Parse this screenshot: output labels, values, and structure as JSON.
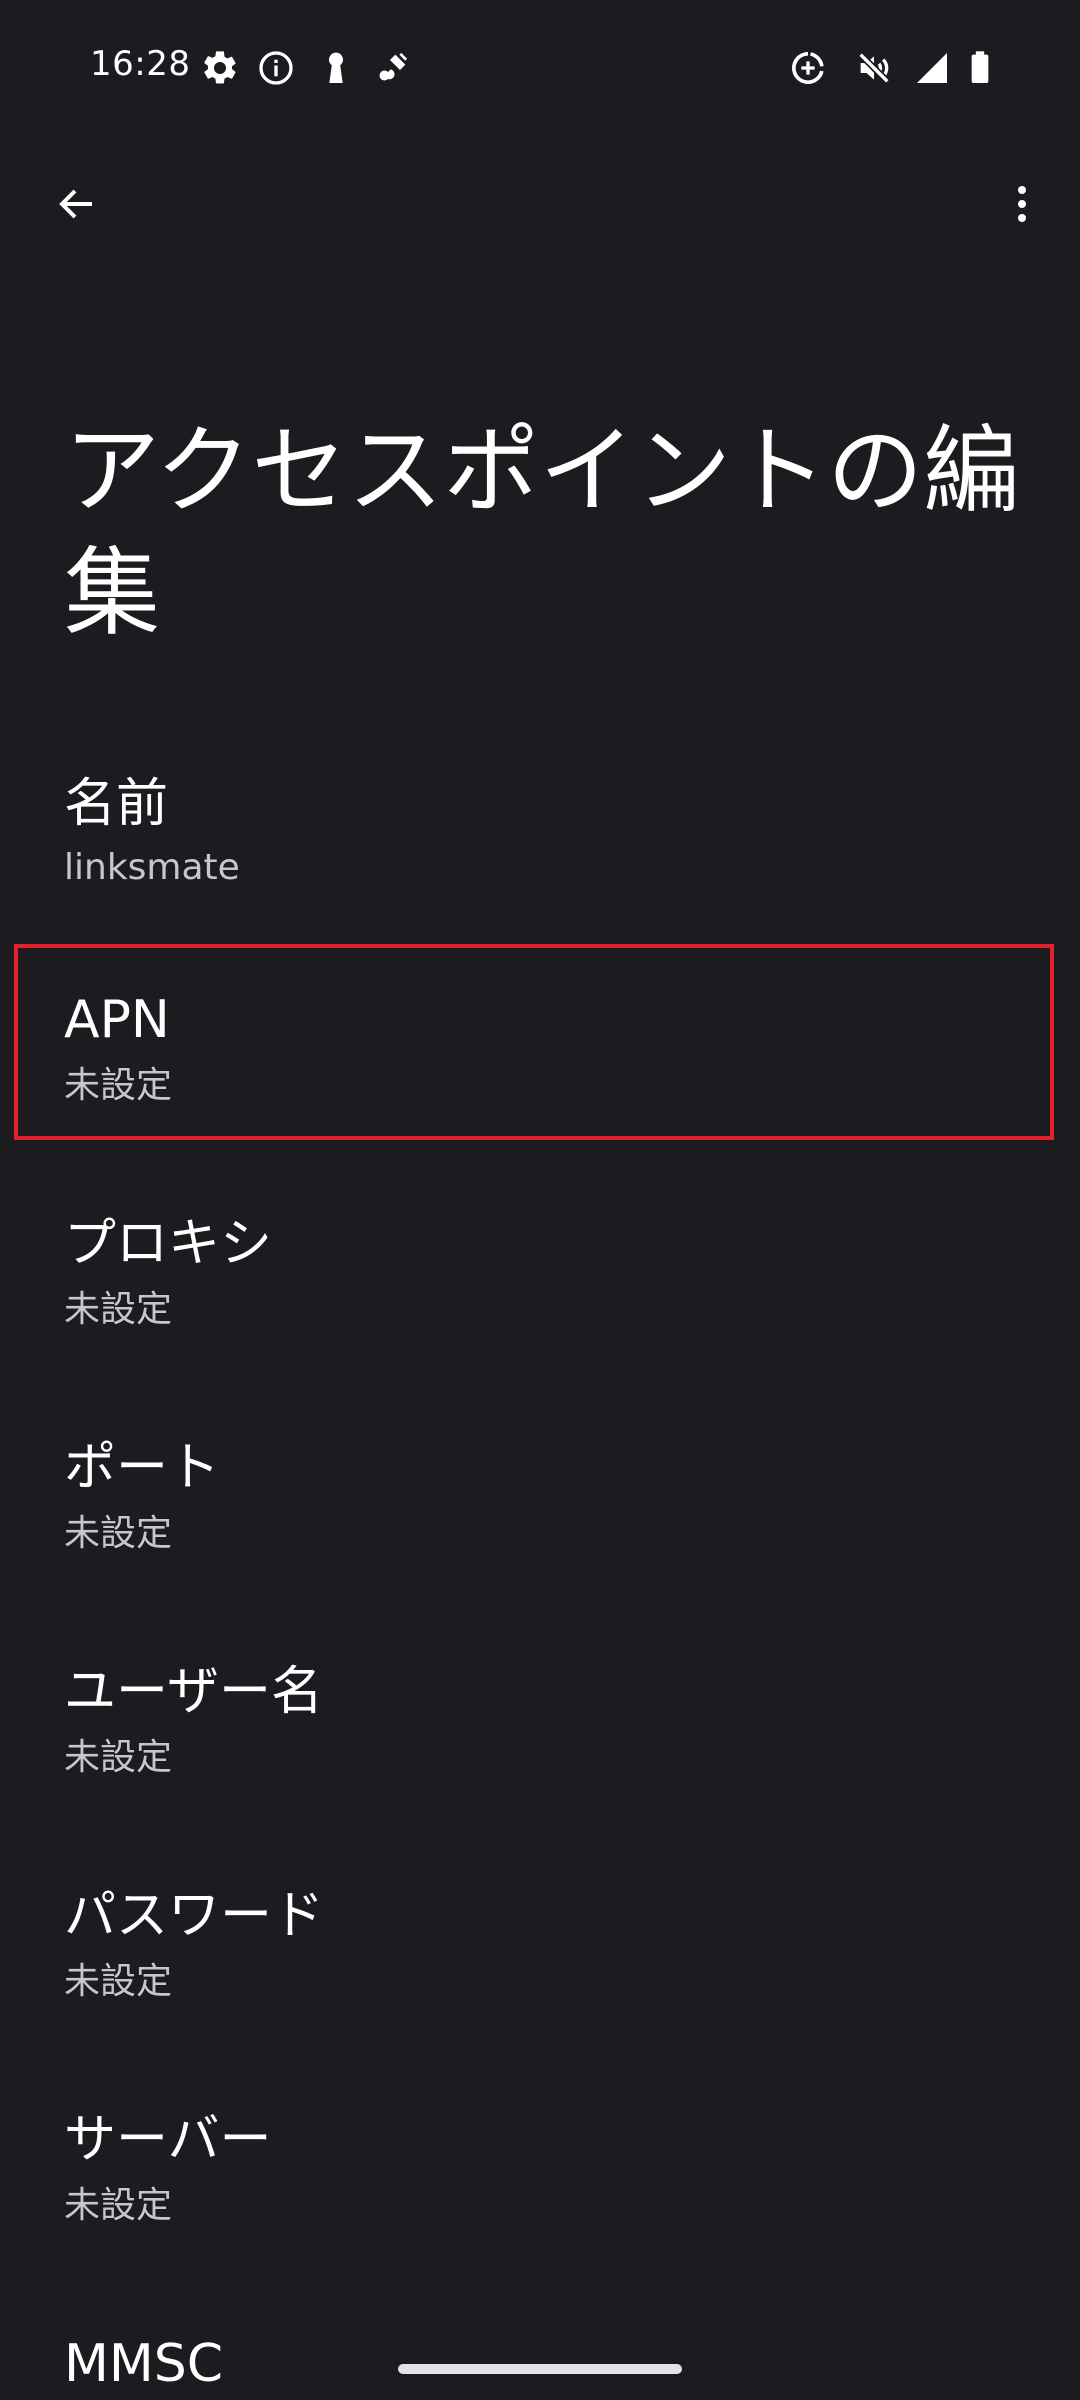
{
  "status_bar": {
    "time": "16:28",
    "left_icons": [
      "settings-icon",
      "info-icon",
      "keyhole-icon",
      "satellite-icon"
    ],
    "right_icons": [
      "data-saver-icon",
      "mute-icon",
      "signal-icon",
      "battery-icon"
    ]
  },
  "app_bar": {
    "back_icon": "arrow-back-icon",
    "menu_icon": "more-vert-icon"
  },
  "page": {
    "title": "アクセスポイントの編集"
  },
  "preferences": [
    {
      "title": "名前",
      "summary": "linksmate"
    },
    {
      "title": "APN",
      "summary": "未設定",
      "highlighted": true
    },
    {
      "title": "プロキシ",
      "summary": "未設定"
    },
    {
      "title": "ポート",
      "summary": "未設定"
    },
    {
      "title": "ユーザー名",
      "summary": "未設定"
    },
    {
      "title": "パスワード",
      "summary": "未設定"
    },
    {
      "title": "サーバー",
      "summary": "未設定"
    },
    {
      "title": "MMSC",
      "summary": ""
    }
  ],
  "colors": {
    "background": "#1c1b20",
    "text_primary": "#ffffff",
    "text_secondary": "#c9c5ca",
    "highlight": "#e3202b"
  }
}
